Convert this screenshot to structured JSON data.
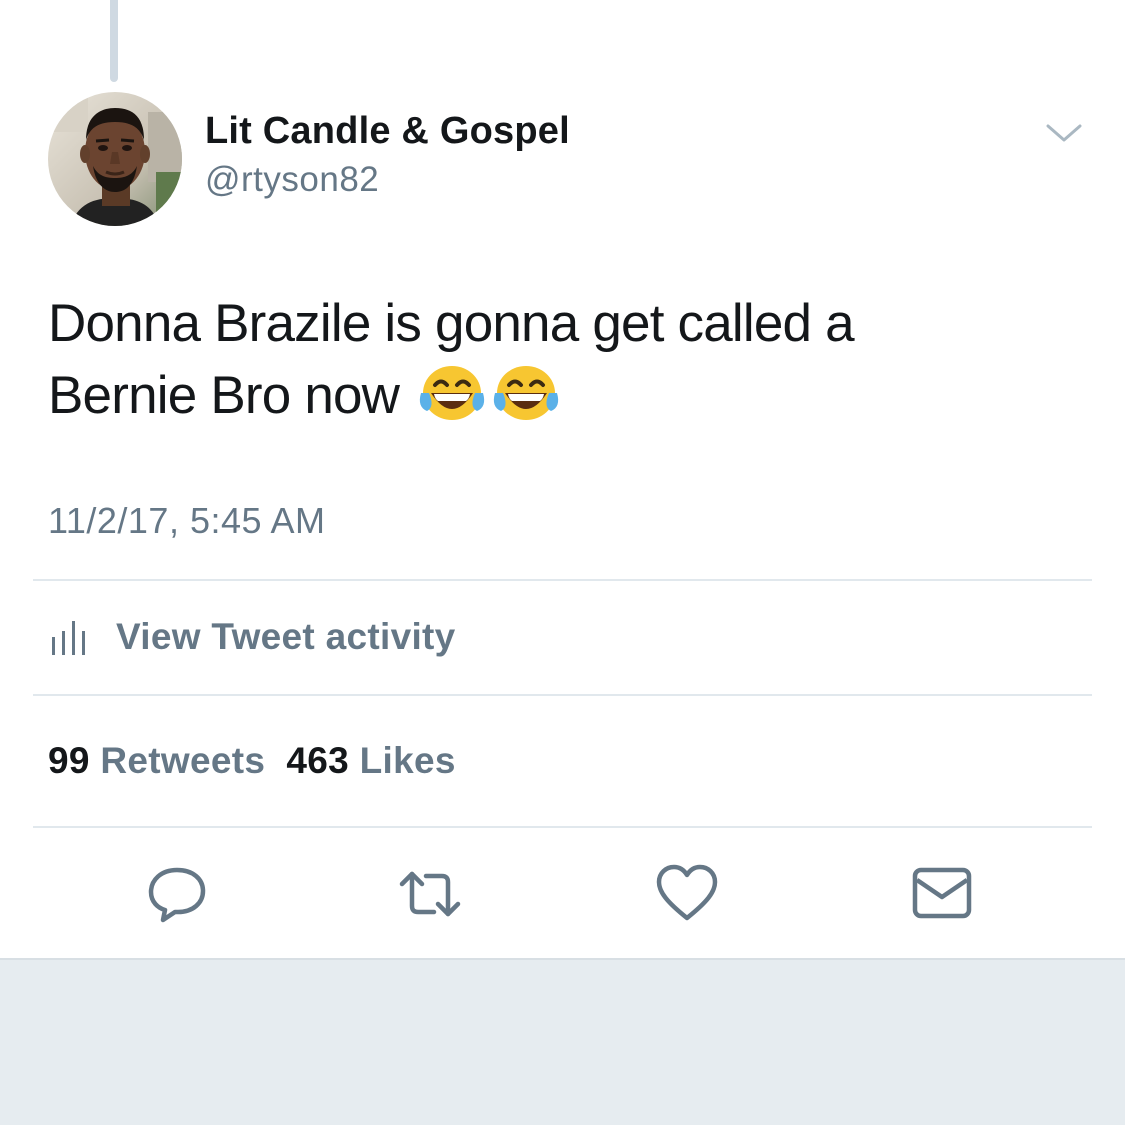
{
  "tweet": {
    "display_name": "Lit Candle & Gospel",
    "handle": "@rtyson82",
    "text_line1": "Donna Brazile is gonna get called a",
    "text_line2": "Bernie Bro now",
    "emoji": [
      "face-with-tears-of-joy",
      "face-with-tears-of-joy"
    ],
    "timestamp": "11/2/17, 5:45 AM"
  },
  "activity": {
    "label": "View Tweet activity",
    "icon": "analytics-bars-icon"
  },
  "stats": {
    "retweets_count": "99",
    "retweets_label": "Retweets",
    "likes_count": "463",
    "likes_label": "Likes"
  },
  "actions": [
    {
      "name": "reply",
      "icon": "reply-bubble-icon"
    },
    {
      "name": "retweet",
      "icon": "retweet-arrows-icon"
    },
    {
      "name": "like",
      "icon": "heart-icon"
    },
    {
      "name": "direct-message",
      "icon": "envelope-icon"
    }
  ],
  "colors": {
    "text_primary": "#14171a",
    "text_secondary": "#657786",
    "divider": "#e1e8ed",
    "background_band": "#e6ecf0",
    "thread_line": "#cfd9e2",
    "icon": "#657786"
  }
}
